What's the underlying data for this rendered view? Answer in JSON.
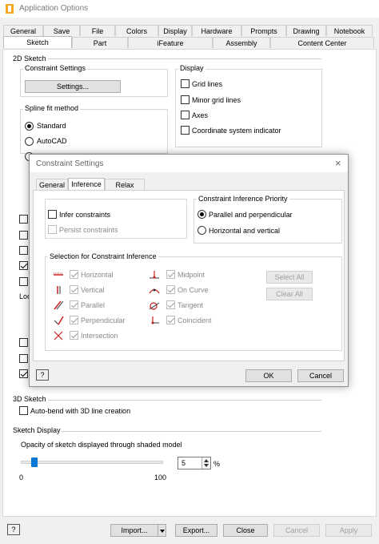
{
  "window": {
    "title": "Application Options"
  },
  "tabs_row1": [
    "General",
    "Save",
    "File",
    "Colors",
    "Display",
    "Hardware",
    "Prompts",
    "Drawing",
    "Notebook"
  ],
  "tabs_row2": [
    "Sketch",
    "Part",
    "iFeature",
    "Assembly",
    "Content Center"
  ],
  "sketch2d": {
    "title": "2D Sketch",
    "constraint_settings": {
      "label": "Constraint Settings",
      "button": "Settings..."
    },
    "spline": {
      "label": "Spline fit method",
      "options": [
        "Standard",
        "AutoCAD"
      ],
      "selected": "Standard"
    },
    "display": {
      "label": "Display",
      "items": [
        "Grid lines",
        "Minor grid lines",
        "Axes",
        "Coordinate system indicator"
      ]
    },
    "partial_label": "Loo"
  },
  "sketch3d": {
    "title": "3D Sketch",
    "auto_bend": "Auto-bend with 3D line creation"
  },
  "sketch_display": {
    "title": "Sketch Display",
    "opacity_label": "Opacity of sketch displayed through shaded model",
    "min": "0",
    "max": "100",
    "value": "5",
    "unit": "%",
    "level": 5
  },
  "bottom_buttons": {
    "import": "Import...",
    "export": "Export...",
    "close": "Close",
    "cancel": "Cancel",
    "apply": "Apply",
    "help": "?"
  },
  "dialog": {
    "title": "Constraint Settings",
    "tabs": [
      "General",
      "Inference",
      "Relax Mode"
    ],
    "infer": {
      "infer_label": "Infer constraints",
      "persist_label": "Persist constraints"
    },
    "priority": {
      "title": "Constraint Inference Priority",
      "options": [
        "Parallel and perpendicular",
        "Horizontal and vertical"
      ]
    },
    "selection": {
      "title": "Selection for Constraint Inference",
      "left": [
        "Horizontal",
        "Vertical",
        "Parallel",
        "Perpendicular",
        "Intersection"
      ],
      "right": [
        "Midpoint",
        "On Curve",
        "Tangent",
        "Coincident"
      ],
      "select_all": "Select All",
      "clear_all": "Clear All"
    },
    "ok": "OK",
    "cancel": "Cancel",
    "help": "?"
  },
  "colors": {
    "accent": "#0078d7",
    "icon_red": "#cc1f1f"
  }
}
